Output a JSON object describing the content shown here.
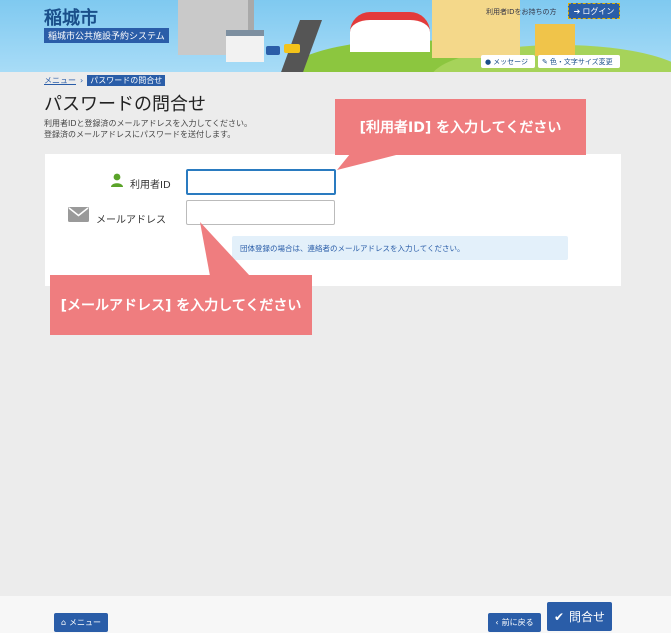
{
  "header": {
    "city_name": "稲城市",
    "system_name": "稲城市公共施設予約システム",
    "login_hint": "利用者IDをお持ちの方",
    "login_label": "ログイン",
    "message_label": "メッセージ",
    "color_label": "色・文字サイズ変更"
  },
  "breadcrumb": {
    "menu": "メニュー",
    "current": "パスワードの問合せ"
  },
  "main": {
    "title": "パスワードの問合せ",
    "description_line1": "利用者IDと登録済のメールアドレスを入力してください。",
    "description_line2": "登録済のメールアドレスにパスワードを送付します。"
  },
  "form": {
    "userid_label": "利用者ID",
    "userid_value": "",
    "email_label": "メールアドレス",
    "email_value": "",
    "group_note": "団体登録の場合は、連絡者のメールアドレスを入力してください。"
  },
  "tooltips": {
    "userid_tip": "[利用者ID] を入力してください",
    "email_tip": "[メールアドレス] を入力してください"
  },
  "footer": {
    "menu_label": "メニュー",
    "back_label": "前に戻る",
    "submit_label": "問合せ"
  },
  "colors": {
    "primary": "#2a5da8",
    "tooltip": "#ef7d7f",
    "note_bg": "#e3f0fa"
  },
  "icons": [
    "home-icon",
    "back-chevron-icon",
    "check-icon",
    "user-icon",
    "mail-icon",
    "login-icon",
    "speech-bubble-icon",
    "pencil-icon"
  ]
}
